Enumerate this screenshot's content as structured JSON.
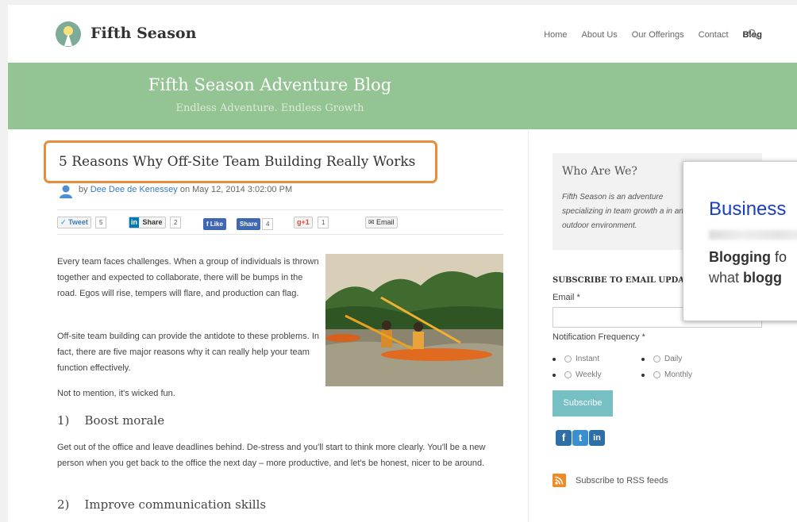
{
  "header": {
    "brand": "Fifth Season",
    "nav": [
      "Home",
      "About Us",
      "Our Offerings",
      "Contact",
      "Blog"
    ],
    "active_nav": "Blog"
  },
  "banner": {
    "title": "Fifth Season Adventure Blog",
    "subtitle": "Endless Adventure. Endless Growth"
  },
  "post": {
    "title": "5 Reasons Why Off-Site Team Building Really Works",
    "by": "by",
    "author": "Dee Dee de Kenessey",
    "date_prefix": "on",
    "date": "May 12, 2014 3:02:00 PM",
    "share": {
      "tweet": "Tweet",
      "tweet_count": "5",
      "linkedin": "Share",
      "linkedin_count": "2",
      "fb_like": "Like",
      "fb_share": "Share",
      "fb_count": "4",
      "gplus": "+1",
      "gplus_count": "1",
      "email": "Email"
    },
    "paragraphs": [
      "Every team faces challenges.  When a group of individuals is thrown together and expected to collaborate, there will be bumps in the road.  Egos will rise, tempers will flare, and production can flag.",
      "Off-site team building can provide the antidote to these problems.  In fact, there are five major reasons why it can really help your team function effectively.",
      "Not to mention, it's wicked fun."
    ],
    "section1_num": "1)",
    "section1_title": "Boost morale",
    "section1_text": "Get out of the office and leave deadlines behind.  De-stress and you'll start to think more clearly.  You'll be a new person when you get back to the office the next day – more productive, and let's be honest, nicer to be around.",
    "section2_num": "2)",
    "section2_title": "Improve communication skills"
  },
  "sidebar": {
    "who_title": "Who Are We?",
    "who_text": "Fifth Season is an adventure specializing in team growth a in an outdoor environment.",
    "subscribe_title": "SUBSCRIBE TO EMAIL UPDAT",
    "email_label": "Email *",
    "freq_label": "Notification Frequency *",
    "freq_options": [
      "Instant",
      "Daily",
      "Weekly",
      "Monthly"
    ],
    "subscribe_button": "Subscribe",
    "rss_text": "Subscribe to RSS feeds"
  },
  "popup": {
    "title": "Business",
    "line2_bold": "Blogging",
    "line2_rest": " fo",
    "line3_rest": "what ",
    "line3_bold": "blogg"
  },
  "colors": {
    "banner": "#94c394",
    "highlight_border": "#e98c3c",
    "link": "#3a7bbf",
    "subscribe": "#76bfc2",
    "popup_title": "#1a3fc0"
  }
}
